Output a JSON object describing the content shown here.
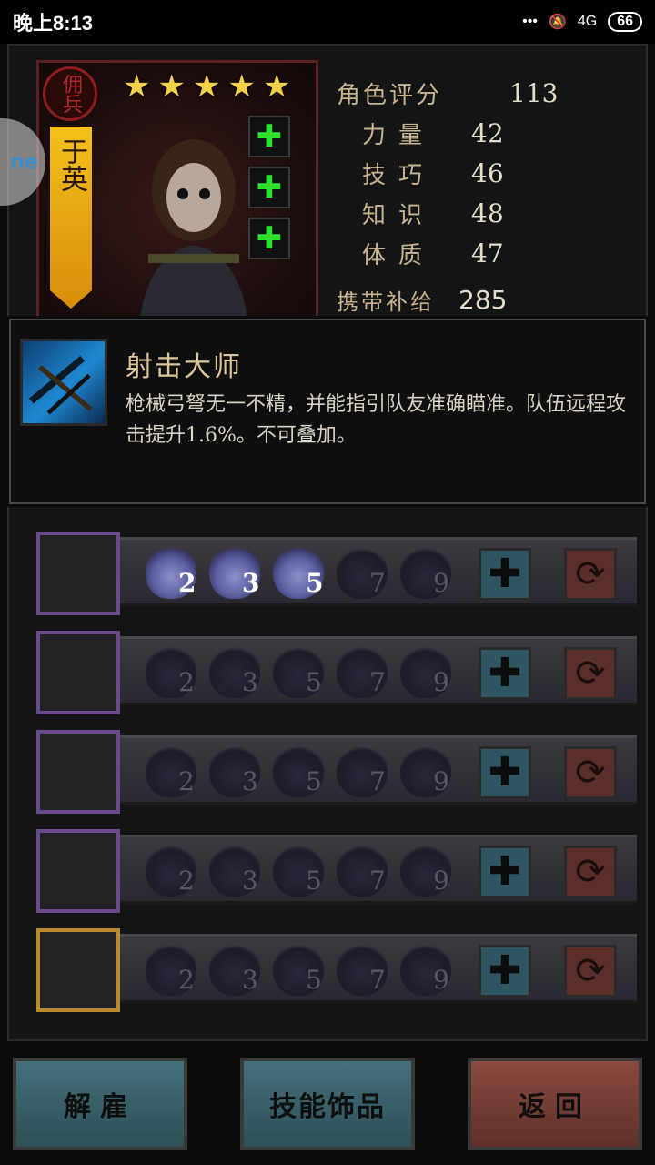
{
  "status_bar": {
    "time": "晚上8:13",
    "signal": "4G",
    "battery": "66"
  },
  "hero": {
    "seal": "佣兵",
    "stars": 5,
    "name": "于英"
  },
  "stats": {
    "score_label": "角色评分",
    "score": "113",
    "items": [
      {
        "label": "力量",
        "value": "42"
      },
      {
        "label": "技巧",
        "value": "46"
      },
      {
        "label": "知识",
        "value": "48"
      },
      {
        "label": "体质",
        "value": "47"
      }
    ],
    "supply_label": "携带补给",
    "supply": "285"
  },
  "tooltip": {
    "title": "射击大师",
    "desc": "枪械弓弩无一不精，并能指引队友准确瞄准。队伍远程攻击提升1.6%。不可叠加。"
  },
  "skills": [
    {
      "levels": [
        "2",
        "3",
        "5",
        "7",
        "9"
      ],
      "active": 3,
      "icon": "crossbow-icon",
      "frame": "#6a4a8a"
    },
    {
      "levels": [
        "2",
        "3",
        "5",
        "7",
        "9"
      ],
      "active": 0,
      "icon": "blade-icon",
      "frame": "#6a4a8a"
    },
    {
      "levels": [
        "2",
        "3",
        "5",
        "7",
        "9"
      ],
      "active": 0,
      "icon": "bag-icon",
      "frame": "#6a4a8a"
    },
    {
      "levels": [
        "2",
        "3",
        "5",
        "7",
        "9"
      ],
      "active": 0,
      "icon": "handshake-icon",
      "frame": "#6a4a8a"
    },
    {
      "levels": [
        "2",
        "3",
        "5",
        "7",
        "9"
      ],
      "active": 0,
      "icon": "energy-hand-icon",
      "frame": "#b88a2a"
    }
  ],
  "buttons": {
    "dismiss": "解雇",
    "skills": "技能饰品",
    "back": "返回"
  },
  "colors": {
    "active_level": "#8c8fc8",
    "add_btn": "#2e5561",
    "swap_btn": "#5a2e29",
    "accent_gold": "#f2d049"
  }
}
